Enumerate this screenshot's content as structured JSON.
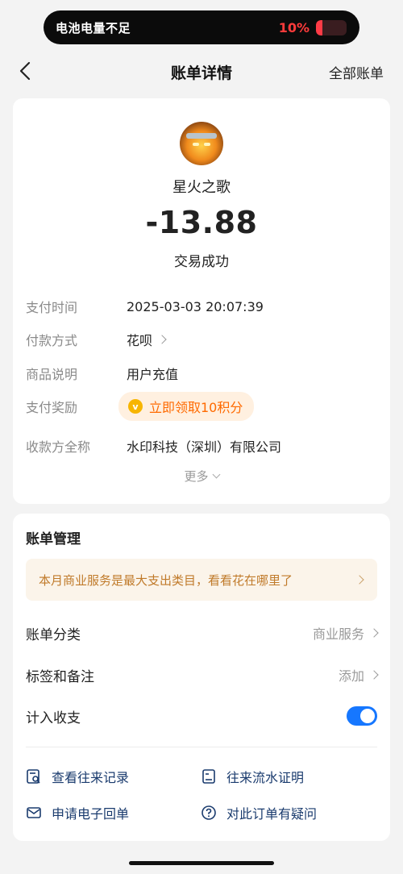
{
  "status_island": {
    "warning": "电池电量不足",
    "battery_pct_text": "10%",
    "battery_level": 0.1
  },
  "nav": {
    "title": "账单详情",
    "right_link": "全部账单"
  },
  "bill": {
    "merchant": "星火之歌",
    "amount": "-13.88",
    "status": "交易成功",
    "rows": [
      {
        "key": "支付时间",
        "value": "2025-03-03 20:07:39"
      },
      {
        "key": "付款方式",
        "value": "花呗"
      },
      {
        "key": "商品说明",
        "value": "用户充值"
      },
      {
        "key": "支付奖励",
        "value": "立即领取10积分"
      },
      {
        "key": "收款方全称",
        "value": "水印科技（深圳）有限公司"
      }
    ],
    "more": "更多"
  },
  "manage": {
    "title": "账单管理",
    "tip": "本月商业服务是最大支出类目，看看花在哪里了",
    "category_label": "账单分类",
    "category_value": "商业服务",
    "tags_label": "标签和备注",
    "tags_value": "添加",
    "income_label": "计入收支",
    "income_enabled": true,
    "actions": [
      "查看往来记录",
      "往来流水证明",
      "申请电子回单",
      "对此订单有疑问"
    ]
  },
  "colors": {
    "accent": "#1677ff",
    "reward": "#ff6a00",
    "tip_text": "#c07a2a",
    "battery": "#ff3b46"
  }
}
